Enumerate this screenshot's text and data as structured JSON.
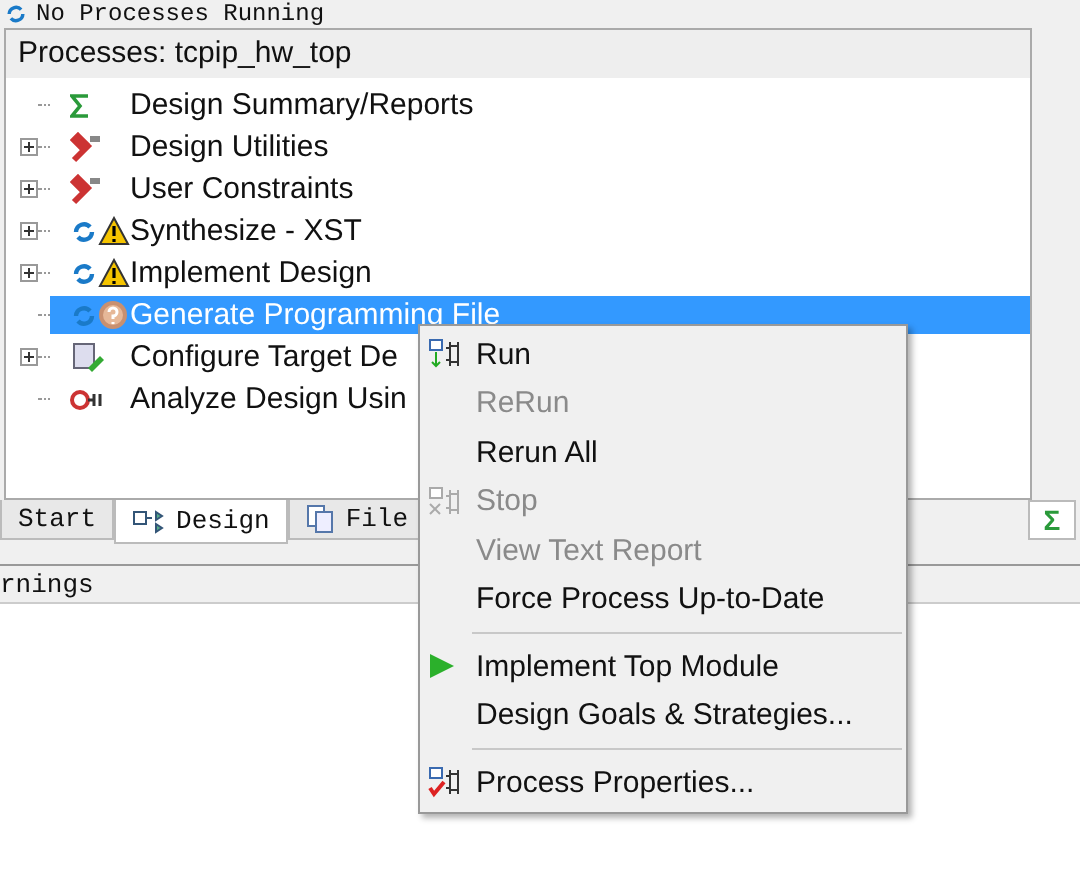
{
  "status_text": "No Processes Running",
  "panel": {
    "title": "Processes: tcpip_hw_top",
    "items": [
      {
        "label": "Design Summary/Reports",
        "kind": "summary",
        "expandable": false,
        "selected": false
      },
      {
        "label": "Design Utilities",
        "kind": "tools",
        "expandable": true,
        "selected": false
      },
      {
        "label": "User Constraints",
        "kind": "tools",
        "expandable": true,
        "selected": false
      },
      {
        "label": "Synthesize - XST",
        "kind": "warning",
        "expandable": true,
        "selected": false
      },
      {
        "label": "Implement Design",
        "kind": "warning",
        "expandable": true,
        "selected": false
      },
      {
        "label": "Generate Programming File",
        "kind": "unknown",
        "expandable": false,
        "selected": true
      },
      {
        "label": "Configure Target De",
        "kind": "configure",
        "expandable": true,
        "selected": false
      },
      {
        "label": "Analyze Design Usin",
        "kind": "analyze",
        "expandable": false,
        "selected": false
      }
    ]
  },
  "tabs": [
    {
      "label": "Start",
      "kind": "none",
      "selected": false
    },
    {
      "label": "Design",
      "kind": "design",
      "selected": true
    },
    {
      "label": "File",
      "kind": "files",
      "selected": false
    }
  ],
  "side_tab": "Σ",
  "console_tab": "rnings",
  "context_menu": [
    {
      "kind": "item",
      "label": "Run",
      "disabled": false
    },
    {
      "kind": "item",
      "label": "ReRun",
      "disabled": true
    },
    {
      "kind": "item",
      "label": "Rerun All",
      "disabled": false
    },
    {
      "kind": "item",
      "label": "Stop",
      "disabled": true
    },
    {
      "kind": "item",
      "label": "View Text Report",
      "disabled": true
    },
    {
      "kind": "item",
      "label": "Force Process Up-to-Date",
      "disabled": false
    },
    {
      "kind": "separator"
    },
    {
      "kind": "item",
      "label": "Implement Top Module",
      "disabled": false
    },
    {
      "kind": "item",
      "label": "Design Goals & Strategies...",
      "disabled": false
    },
    {
      "kind": "separator"
    },
    {
      "kind": "item",
      "label": "Process Properties...",
      "disabled": false
    }
  ]
}
